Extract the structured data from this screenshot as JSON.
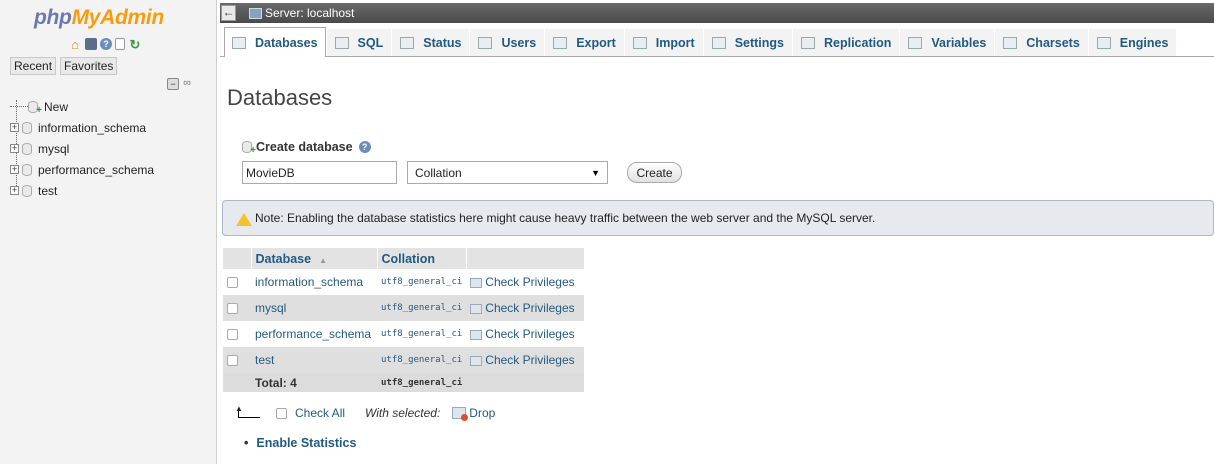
{
  "nav": {
    "logo_php": "php",
    "logo_myadmin": "MyAdmin",
    "tabs": [
      "Recent",
      "Favorites"
    ],
    "tree": [
      {
        "label": "New",
        "is_new": true
      },
      {
        "label": "information_schema"
      },
      {
        "label": "mysql"
      },
      {
        "label": "performance_schema"
      },
      {
        "label": "test"
      }
    ]
  },
  "server_bar": {
    "title": "Server: localhost"
  },
  "tabs": [
    {
      "label": "Databases",
      "icon": "database-icon",
      "active": true
    },
    {
      "label": "SQL",
      "icon": "sql-icon"
    },
    {
      "label": "Status",
      "icon": "status-icon"
    },
    {
      "label": "Users",
      "icon": "users-icon"
    },
    {
      "label": "Export",
      "icon": "export-icon"
    },
    {
      "label": "Import",
      "icon": "import-icon"
    },
    {
      "label": "Settings",
      "icon": "settings-icon"
    },
    {
      "label": "Replication",
      "icon": "replication-icon"
    },
    {
      "label": "Variables",
      "icon": "variables-icon"
    },
    {
      "label": "Charsets",
      "icon": "charsets-icon"
    },
    {
      "label": "Engines",
      "icon": "engines-icon"
    }
  ],
  "page": {
    "title": "Databases",
    "create_label": "Create database",
    "dbname_value": "MovieDB",
    "collation_value": "Collation",
    "create_button": "Create",
    "notice": "Note: Enabling the database statistics here might cause heavy traffic between the web server and the MySQL server."
  },
  "table": {
    "headers": {
      "database": "Database",
      "collation": "Collation"
    },
    "rows": [
      {
        "name": "information_schema",
        "collation": "utf8_general_ci",
        "action": "Check Privileges"
      },
      {
        "name": "mysql",
        "collation": "utf8_general_ci",
        "action": "Check Privileges"
      },
      {
        "name": "performance_schema",
        "collation": "utf8_general_ci",
        "action": "Check Privileges"
      },
      {
        "name": "test",
        "collation": "utf8_general_ci",
        "action": "Check Privileges"
      }
    ],
    "total_label": "Total: 4",
    "total_collation": "utf8_general_ci"
  },
  "bulk": {
    "check_all": "Check All",
    "with_selected": "With selected:",
    "drop": "Drop"
  },
  "enable_statistics": "Enable Statistics",
  "colors": {
    "link": "#235a81",
    "logo_blue": "#6c78af",
    "logo_orange": "#f89c0e",
    "server_bar": "#555555"
  }
}
